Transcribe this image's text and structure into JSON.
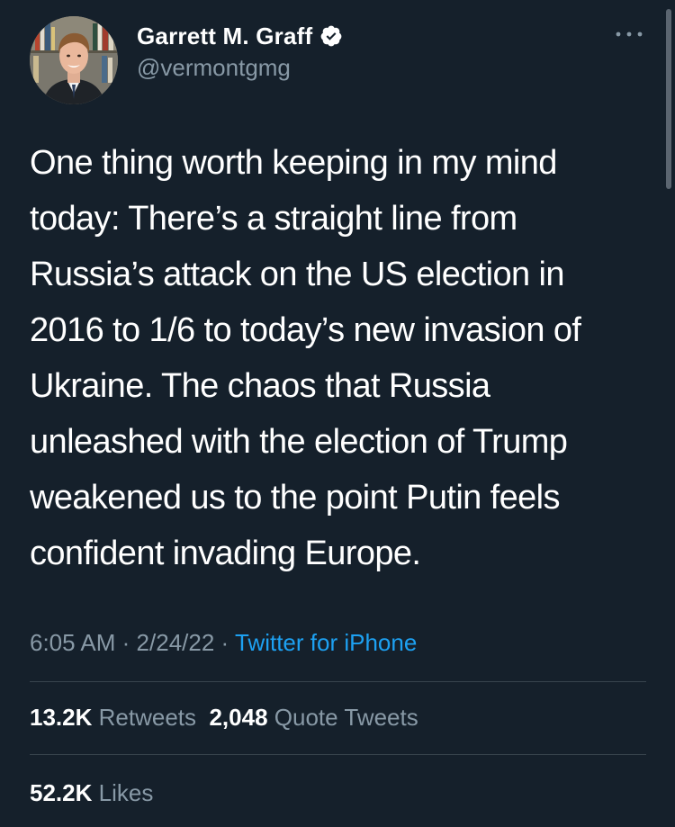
{
  "author": {
    "display_name": "Garrett M. Graff",
    "handle": "@vermontgmg",
    "verified": true,
    "verified_color": "#ffffff"
  },
  "tweet": {
    "text_lines": [
      "One thing worth keeping in my mind",
      "today: There’s a straight line from",
      "Russia’s attack on the US election in",
      "2016 to 1/6 to today’s new invasion of",
      "Ukraine. The chaos that Russia",
      "unleashed with the election of Trump",
      "weakened us to the point Putin feels",
      "confident invading Europe."
    ],
    "time": "6:05 AM",
    "separator": "·",
    "date": "2/24/22",
    "source": "Twitter for iPhone"
  },
  "stats": {
    "retweets_count": "13.2K",
    "retweets_label": "Retweets",
    "quotes_count": "2,048",
    "quotes_label": "Quote Tweets",
    "likes_count": "52.2K",
    "likes_label": "Likes"
  },
  "colors": {
    "background": "#15202b",
    "secondary_text": "#8899a6",
    "link": "#1da1f2",
    "divider": "#38444d"
  },
  "icons": {
    "more": "more-options-icon",
    "verified": "verified-badge-icon"
  }
}
